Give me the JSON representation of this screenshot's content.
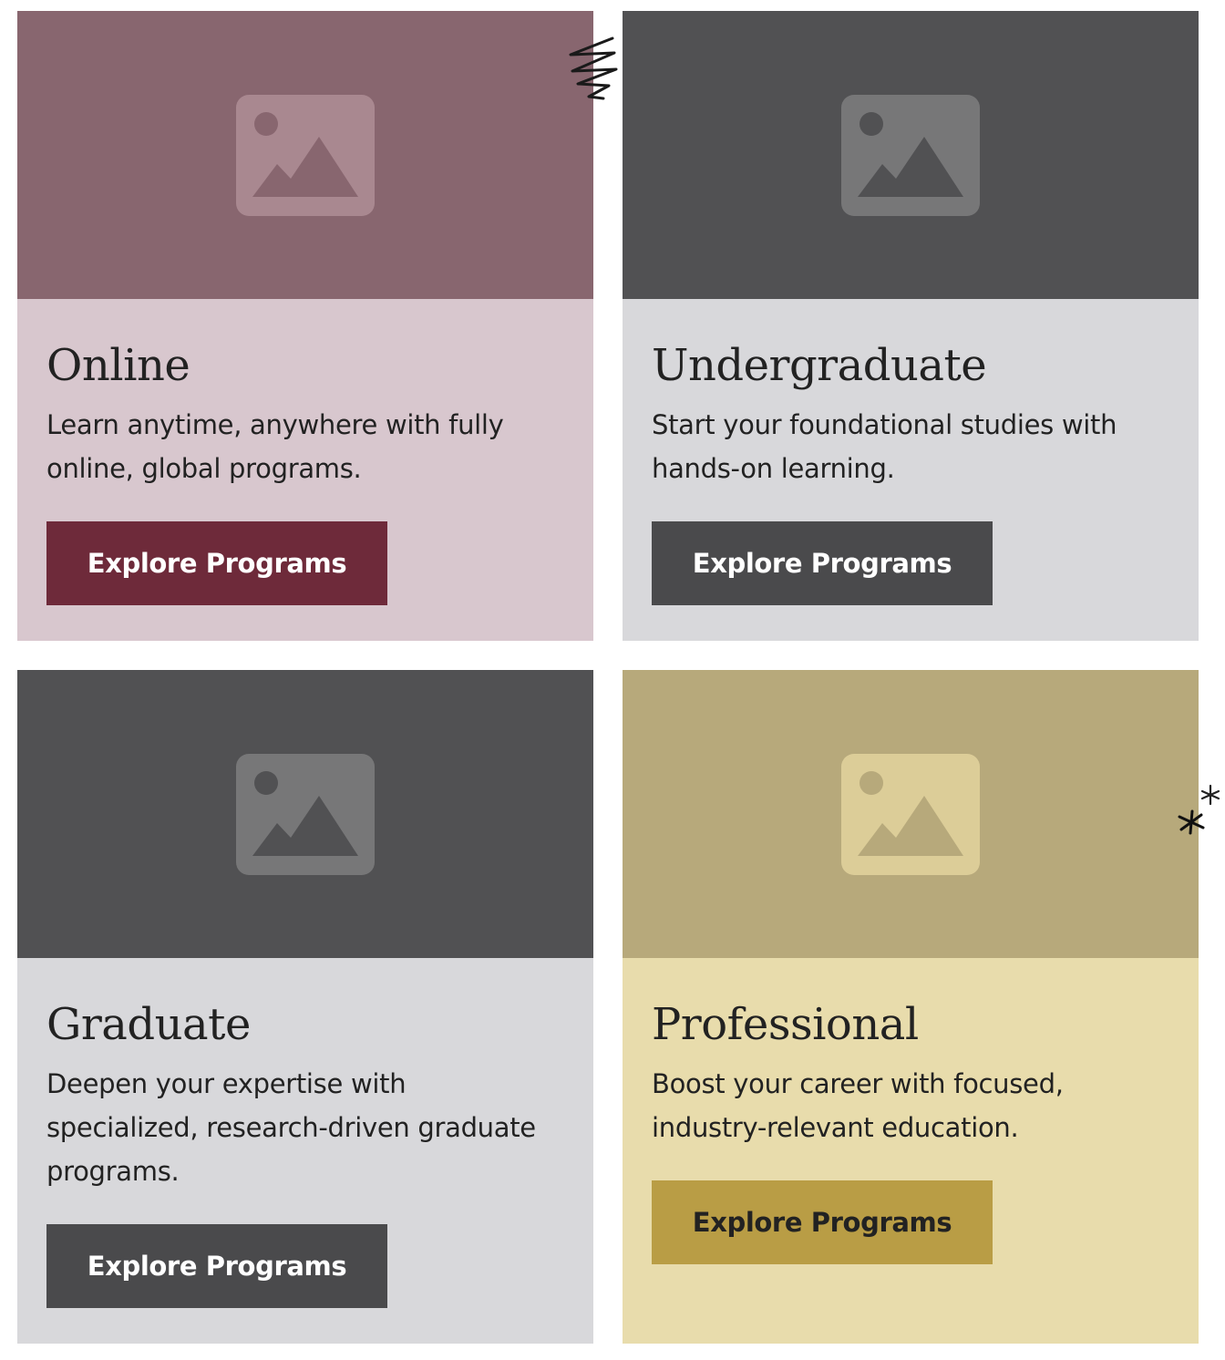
{
  "cards": [
    {
      "title": "Online",
      "description": "Learn anytime, anywhere with fully online, global programs.",
      "button_label": "Explore Programs",
      "image_icon": "image-placeholder-icon",
      "colors": {
        "image_bg": "#88666f",
        "icon": "#a98890",
        "body_bg": "#d8c7ce",
        "button_bg": "#6e2a3a",
        "button_text": "#ffffff"
      }
    },
    {
      "title": "Undergraduate",
      "description": "Start your foundational studies with hands-on learning.",
      "button_label": "Explore Programs",
      "image_icon": "image-placeholder-icon",
      "colors": {
        "image_bg": "#515153",
        "icon": "#777778",
        "body_bg": "#d8d8db",
        "button_bg": "#4a4a4c",
        "button_text": "#ffffff"
      }
    },
    {
      "title": "Graduate",
      "description": "Deepen your expertise with specialized, research-driven graduate programs.",
      "button_label": "Explore Programs",
      "image_icon": "image-placeholder-icon",
      "colors": {
        "image_bg": "#515153",
        "icon": "#777778",
        "body_bg": "#d8d8db",
        "button_bg": "#4a4a4c",
        "button_text": "#ffffff"
      }
    },
    {
      "title": "Professional",
      "description": "Boost your career with focused, industry-relevant education.",
      "button_label": "Explore Programs",
      "image_icon": "image-placeholder-icon",
      "colors": {
        "image_bg": "#b7a97b",
        "icon": "#dccd98",
        "body_bg": "#e8dcac",
        "button_bg": "#b99d45",
        "button_text": "#222222"
      }
    }
  ]
}
